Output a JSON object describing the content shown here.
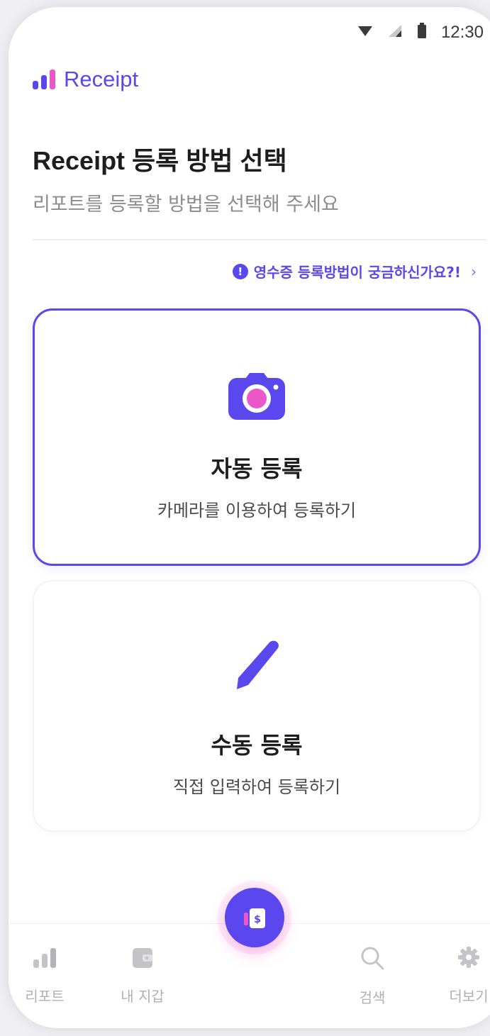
{
  "status": {
    "time": "12:30",
    "icons": [
      "wifi-icon",
      "signal-icon",
      "battery-icon"
    ]
  },
  "brand": {
    "name": "Receipt",
    "icon": "bar-chart-logo-icon",
    "colors": [
      "#5a48ee",
      "#5a48ee",
      "#eb56c8"
    ]
  },
  "header": {
    "title": "Receipt 등록 방법 선택",
    "subtitle": "리포트를 등록할 방법을 선택해 주세요"
  },
  "help_link": {
    "text": "영수증 등록방법이 궁금하신가요?!",
    "icon": "info-icon"
  },
  "options": [
    {
      "title": "자동 등록",
      "desc": "카메라를 이용하여 등록하기",
      "icon": "camera-icon",
      "selected": true
    },
    {
      "title": "수동 등록",
      "desc": "직접 입력하여 등록하기",
      "icon": "pencil-icon",
      "selected": false
    }
  ],
  "bottom_nav": {
    "items": [
      {
        "label": "리포트",
        "icon": "report-icon"
      },
      {
        "label": "내 지갑",
        "icon": "wallet-icon"
      },
      {
        "label": "검색",
        "icon": "search-icon"
      },
      {
        "label": "더보기",
        "icon": "gear-icon"
      }
    ],
    "fab": {
      "icon": "receipt-add-icon"
    }
  },
  "colors": {
    "accent": "#5a48ee",
    "pink": "#eb56c8",
    "text": "#1d1d1f",
    "muted": "#8c8c92"
  }
}
